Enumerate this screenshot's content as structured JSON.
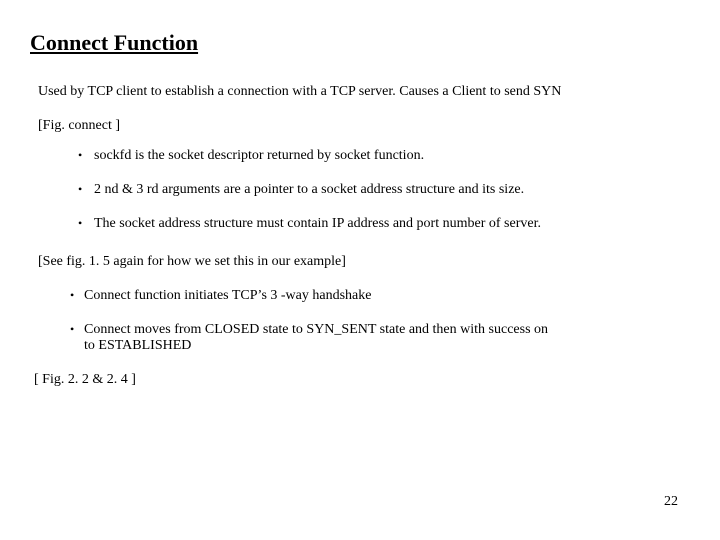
{
  "title": "Connect Function",
  "intro": "Used by TCP client to establish a connection with a TCP server. Causes a Client to send SYN",
  "fig_note": "[Fig. connect ]",
  "bullets1": {
    "0": "sockfd is the socket descriptor returned by socket function.",
    "1": "2 nd & 3 rd arguments are a pointer to a socket address structure and its size.",
    "2": "The socket address structure must contain IP address and port number of server."
  },
  "see_note": "[See fig. 1. 5 again for how we set this in our example]",
  "bullets2": {
    "0": "Connect function initiates TCP’s 3 -way handshake",
    "1": "Connect moves from CLOSED state to SYN_SENT state and then with success on to ESTABLISHED"
  },
  "fig_ref": "[ Fig. 2. 2 & 2. 4 ]",
  "page_num": "22"
}
